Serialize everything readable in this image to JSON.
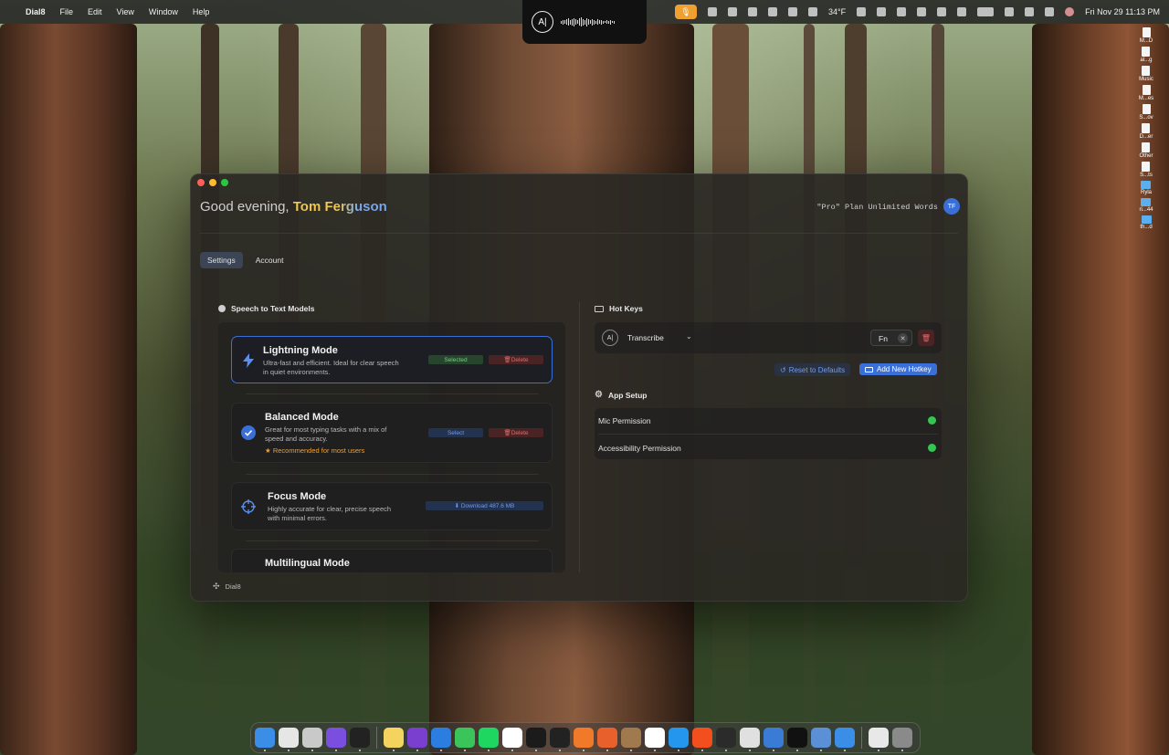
{
  "menubar": {
    "app_name": "Dial8",
    "menus": [
      "File",
      "Edit",
      "View",
      "Window",
      "Help"
    ],
    "temperature": "34°F",
    "datetime": "Fri Nov 29  11:13 PM"
  },
  "notch": {
    "logo_text": "A|"
  },
  "desktop_items": [
    {
      "label": "M...D",
      "kind": "drive"
    },
    {
      "label": "al...g",
      "kind": "doc"
    },
    {
      "label": "Music",
      "kind": "doc"
    },
    {
      "label": "M...es",
      "kind": "doc"
    },
    {
      "label": "S...ov",
      "kind": "doc"
    },
    {
      "label": "D...er",
      "kind": "doc"
    },
    {
      "label": "Other",
      "kind": "doc"
    },
    {
      "label": "S...ts",
      "kind": "doc"
    },
    {
      "label": "Ryla",
      "kind": "folder"
    },
    {
      "label": "ri...44",
      "kind": "folder"
    },
    {
      "label": "th...d",
      "kind": "folder"
    }
  ],
  "window": {
    "greeting_prefix": "Good evening, ",
    "user_name": "Tom Ferguson",
    "plan_text": "\"Pro\" Plan Unlimited Words",
    "avatar_initials": "TF",
    "tabs": [
      {
        "label": "Settings",
        "active": true
      },
      {
        "label": "Account",
        "active": false
      }
    ],
    "models": {
      "title": "Speech to Text Models",
      "items": [
        {
          "title": "Lightning Mode",
          "desc": "Ultra-fast and efficient. Ideal for clear speech in quiet environments.",
          "primary_action": "Selected",
          "delete_label": "Delete",
          "icon": "lightning-icon"
        },
        {
          "title": "Balanced Mode",
          "desc": "Great for most typing tasks with a mix of speed and accuracy.",
          "recommended": "Recommended for most users",
          "primary_action": "Select",
          "delete_label": "Delete",
          "icon": "checkmark-icon"
        },
        {
          "title": "Focus Mode",
          "desc": "Highly accurate for clear, precise speech with minimal errors.",
          "primary_action": "Download 487.6 MB",
          "icon": "crosshair-icon"
        },
        {
          "title": "Multilingual Mode"
        }
      ]
    },
    "hotkeys": {
      "title": "Hot Keys",
      "action_label": "Transcribe",
      "key_label": "Fn",
      "reset_label": "Reset to Defaults",
      "add_label": "Add New Hotkey"
    },
    "app_setup": {
      "title": "App Setup",
      "items": [
        {
          "label": "Mic Permission",
          "status": "ok"
        },
        {
          "label": "Accessibility Permission",
          "status": "ok"
        }
      ]
    },
    "footer_label": "Dial8"
  },
  "colors": {
    "accent": "#3b6fd8",
    "success": "#33c750",
    "danger": "#e06a6a",
    "warning": "#f0a030"
  }
}
